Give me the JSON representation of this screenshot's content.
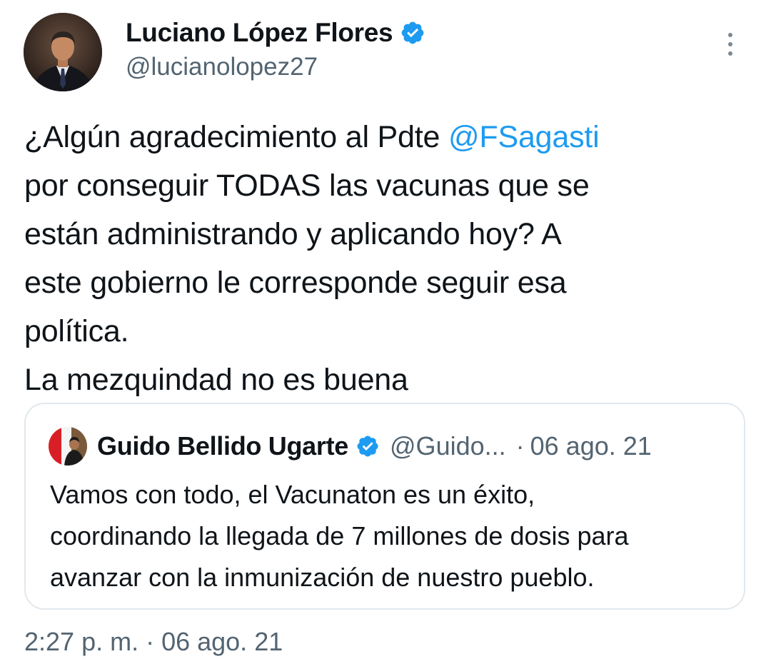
{
  "author": {
    "name": "Luciano López Flores",
    "handle": "@lucianolopez27",
    "verified": true,
    "avatar_icon": "profile-photo"
  },
  "tweet": {
    "lines": [
      {
        "before": "¿Algún agradecimiento al Pdte ",
        "mention": "@FSagasti"
      },
      {
        "text": "por conseguir TODAS las vacunas que se"
      },
      {
        "text": "están administrando y aplicando hoy? A"
      },
      {
        "text": "este gobierno le corresponde seguir esa"
      },
      {
        "text": "política."
      },
      {
        "text": "La mezquindad no es buena"
      }
    ]
  },
  "quoted_tweet": {
    "name": "Guido Bellido Ugarte",
    "handle": "@Guido...",
    "separator": "·",
    "date": "06 ago. 21",
    "verified": true,
    "lines": [
      "Vamos con todo,  el Vacunaton  es un éxito,",
      "coordinando la llegada de 7 millones de dosis para",
      "avanzar con la inmunización de nuestro pueblo."
    ]
  },
  "footer": {
    "timestamp": "2:27 p. m. · 06 ago. 21"
  },
  "colors": {
    "accent": "#1d9bf0",
    "text": "#0f1419",
    "secondary": "#536471",
    "border": "#e1e8ed"
  },
  "icons": [
    "verified-badge-icon",
    "more-options-icon"
  ]
}
